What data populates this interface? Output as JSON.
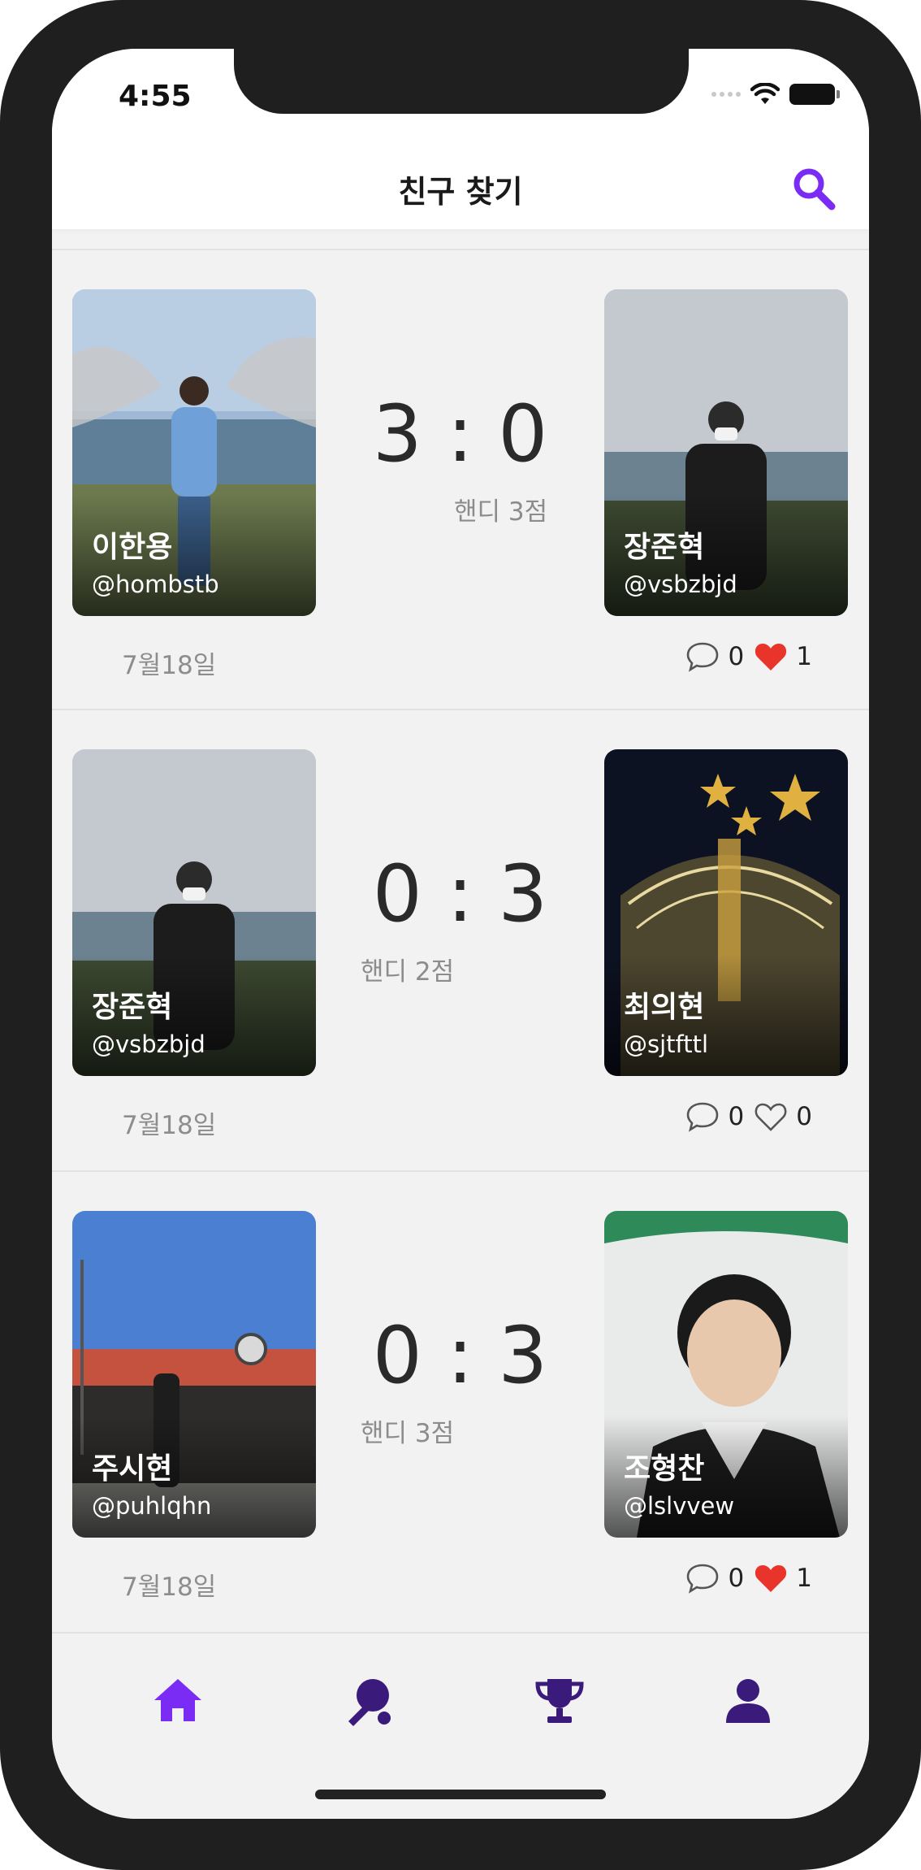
{
  "status_bar": {
    "time": "4:55"
  },
  "header": {
    "title": "친구 찾기",
    "search_icon": "search-icon"
  },
  "colors": {
    "accent": "#7a2cf5",
    "heart": "#e8342b",
    "tab_dark": "#3a1a7a"
  },
  "matches": [
    {
      "left": {
        "name": "이한용",
        "handle": "@hombstb"
      },
      "right": {
        "name": "장준혁",
        "handle": "@vsbzbjd"
      },
      "score": "3 : 0",
      "handicap": "핸디 3점",
      "handicap_side": "right",
      "date": "7월18일",
      "comments": "0",
      "likes": "1",
      "liked": true
    },
    {
      "left": {
        "name": "장준혁",
        "handle": "@vsbzbjd"
      },
      "right": {
        "name": "최의현",
        "handle": "@sjtfttl"
      },
      "score": "0 : 3",
      "handicap": "핸디 2점",
      "handicap_side": "left",
      "date": "7월18일",
      "comments": "0",
      "likes": "0",
      "liked": false
    },
    {
      "left": {
        "name": "주시현",
        "handle": "@puhlqhn"
      },
      "right": {
        "name": "조형찬",
        "handle": "@lslvvew"
      },
      "score": "0 : 3",
      "handicap": "핸디 3점",
      "handicap_side": "left",
      "date": "7월18일",
      "comments": "0",
      "likes": "1",
      "liked": true
    }
  ],
  "tabs": [
    {
      "icon": "home-icon",
      "active": true
    },
    {
      "icon": "ping-pong-icon",
      "active": false
    },
    {
      "icon": "trophy-icon",
      "active": false
    },
    {
      "icon": "profile-icon",
      "active": false
    }
  ]
}
